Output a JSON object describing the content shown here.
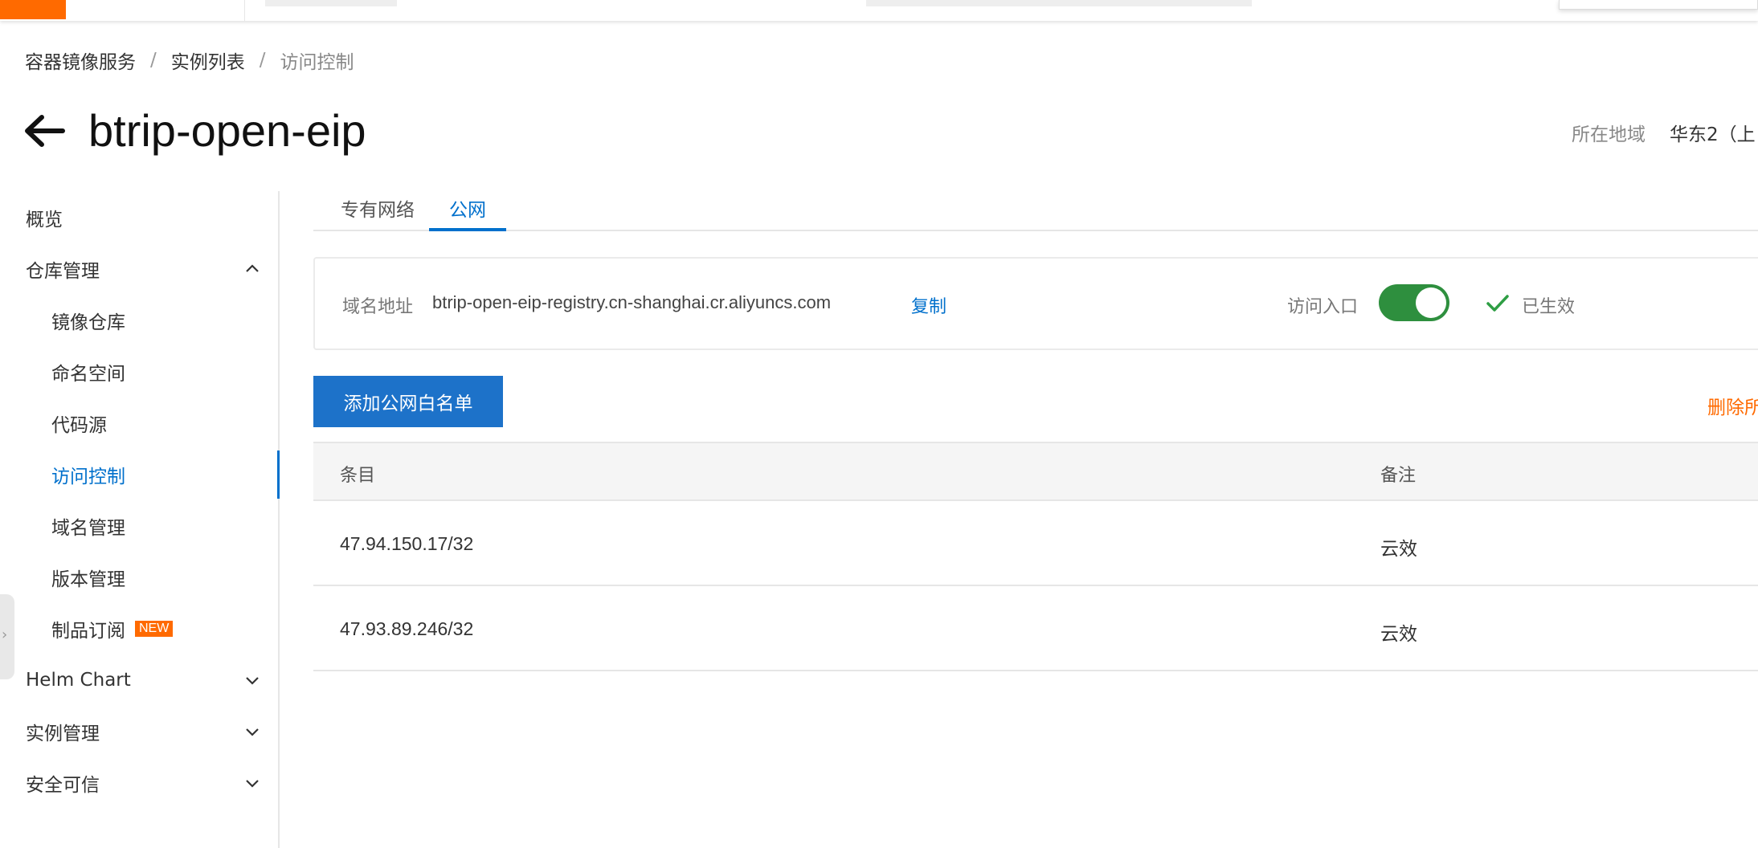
{
  "breadcrumb": {
    "items": [
      "容器镜像服务",
      "实例列表",
      "访问控制"
    ],
    "separator": "/"
  },
  "header": {
    "title": "btrip-open-eip",
    "region_label": "所在地域",
    "region_value": "华东2（上"
  },
  "sidebar": {
    "overview": "概览",
    "repo_mgmt": "仓库管理",
    "image_repo": "镜像仓库",
    "namespace": "命名空间",
    "code_source": "代码源",
    "access_control": "访问控制",
    "domain_mgmt": "域名管理",
    "version_mgmt": "版本管理",
    "artifact_sub": "制品订阅",
    "new_badge": "NEW",
    "helm_chart": "Helm Chart",
    "instance_mgmt": "实例管理",
    "security": "安全可信"
  },
  "tabs": {
    "vpc": "专有网络",
    "public": "公网"
  },
  "domain_card": {
    "label": "域名地址",
    "value": "btrip-open-eip-registry.cn-shanghai.cr.aliyuncs.com",
    "copy": "复制",
    "entry_label": "访问入口",
    "toggle_on": true,
    "status": "已生效"
  },
  "actions": {
    "add_whitelist": "添加公网白名单",
    "delete_all": "删除所"
  },
  "table": {
    "columns": [
      "条目",
      "备注"
    ],
    "rows": [
      {
        "entry": "47.94.150.17/32",
        "note": "云效"
      },
      {
        "entry": "47.93.89.246/32",
        "note": "云效"
      }
    ]
  },
  "colors": {
    "accent": "#0070cc",
    "button": "#1d72c9",
    "brand": "#ff6a00",
    "toggle": "#2e8f3e"
  }
}
